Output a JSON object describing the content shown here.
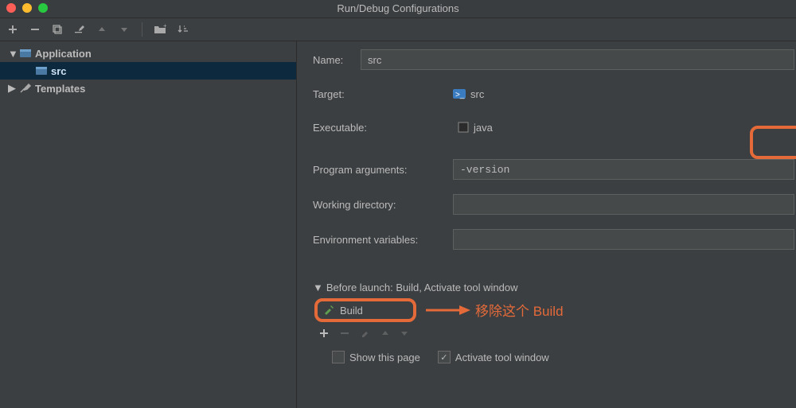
{
  "window": {
    "title": "Run/Debug Configurations"
  },
  "sidebar": {
    "app_label": "Application",
    "src_label": "src",
    "templates_label": "Templates"
  },
  "form": {
    "name_label": "Name:",
    "name_value": "src",
    "target_label": "Target:",
    "target_value": "src",
    "executable_label": "Executable:",
    "executable_value": "java",
    "args_label": "Program arguments:",
    "args_value": "-version",
    "wd_label": "Working directory:",
    "wd_value": "",
    "env_label": "Environment variables:",
    "env_value": ""
  },
  "before_launch": {
    "header": "Before launch: Build, Activate tool window",
    "build_label": "Build",
    "show_this_page": "Show this page",
    "activate_tool_window": "Activate tool window"
  },
  "annotation": {
    "text": "移除这个 Build"
  }
}
